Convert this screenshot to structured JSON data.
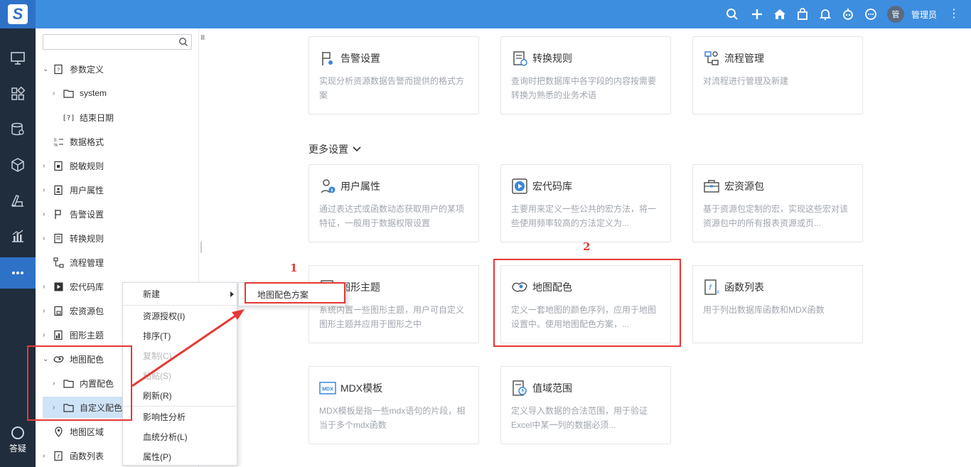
{
  "topbar": {
    "username": "管理员",
    "avatar_text": "管",
    "more": "⋮"
  },
  "nav": {
    "help_label": "答疑"
  },
  "tree": {
    "search_placeholder": "",
    "nodes": [
      {
        "label": "参数定义"
      },
      {
        "label": "system"
      },
      {
        "label": "结束日期"
      },
      {
        "label": "数据格式"
      },
      {
        "label": "脱敏规则"
      },
      {
        "label": "用户属性"
      },
      {
        "label": "告警设置"
      },
      {
        "label": "转换规则"
      },
      {
        "label": "流程管理"
      },
      {
        "label": "宏代码库"
      },
      {
        "label": "宏资源包"
      },
      {
        "label": "图形主题"
      },
      {
        "label": "地图配色"
      },
      {
        "label": "内置配色"
      },
      {
        "label": "自定义配色"
      },
      {
        "label": "地图区域"
      },
      {
        "label": "函数列表"
      }
    ]
  },
  "context_menu": {
    "items": [
      {
        "label": "新建"
      },
      {
        "label": "资源授权(I)"
      },
      {
        "label": "排序(T)"
      },
      {
        "label": "复制(C)"
      },
      {
        "label": "粘贴(S)"
      },
      {
        "label": "刷新(R)"
      },
      {
        "label": "影响性分析"
      },
      {
        "label": "血统分析(L)"
      },
      {
        "label": "属性(P)"
      }
    ],
    "submenu_item": "地图配色方案"
  },
  "annotations": {
    "one": "1",
    "two": "2"
  },
  "cards_top": [
    {
      "title": "告警设置",
      "desc": "实现分析资源数据告警而提供的格式方案"
    },
    {
      "title": "转换规则",
      "desc": "查询时把数据库中各字段的内容按需要转换为熟悉的业务术语"
    },
    {
      "title": "流程管理",
      "desc": "对流程进行管理及新建"
    }
  ],
  "more_settings_label": "更多设置",
  "cards_more": [
    {
      "title": "用户属性",
      "desc": "通过表达式或函数动态获取用户的某项特征，一般用于数据权限设置"
    },
    {
      "title": "宏代码库",
      "desc": "主要用来定义一些公共的宏方法，将一些使用频率较高的方法定义为..."
    },
    {
      "title": "宏资源包",
      "desc": "基于资源包定制的宏，实现这些宏对该资源包中的所有报表资源或页..."
    },
    {
      "title": "图形主题",
      "desc": "系统内置一些图形主题，用户可自定义图形主题并应用于图形之中"
    },
    {
      "title": "地图配色",
      "desc": "定义一套地图的颜色序列，应用于地图设置中。使用地图配色方案，..."
    },
    {
      "title": "函数列表",
      "desc": "用于列出数据库函数和MDX函数"
    },
    {
      "title": "MDX模板",
      "desc": "MDX模板是指一些mdx语句的片段，相当于多个mdx函数"
    },
    {
      "title": "值域范围",
      "desc": "定义导入数据的合法范围，用于验证Excel中某一列的数据必须..."
    }
  ],
  "colors": {
    "topbar": "#3e8ee0",
    "nav": "#1f2d3d",
    "accent": "#2e72c8",
    "annotation": "#e53935",
    "icon_blue": "#3a87d8"
  }
}
